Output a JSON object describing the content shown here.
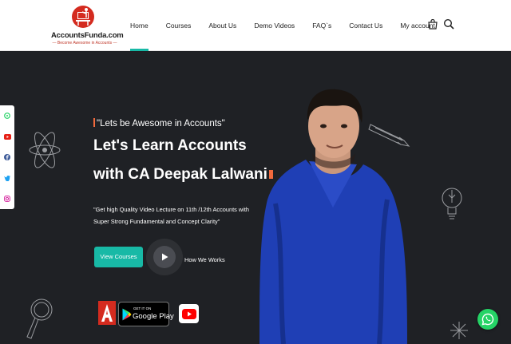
{
  "brand": {
    "name": "AccountsFunda.com",
    "tagline": "— Become Awesome in Accounts —",
    "color": "#d42b1f"
  },
  "nav": {
    "items": [
      {
        "label": "Home",
        "active": true
      },
      {
        "label": "Courses",
        "active": false
      },
      {
        "label": "About Us",
        "active": false
      },
      {
        "label": "Demo Videos",
        "active": false
      },
      {
        "label": "FAQ`s",
        "active": false
      },
      {
        "label": "Contact Us",
        "active": false
      },
      {
        "label": "My account",
        "active": false
      }
    ],
    "icons": [
      "cart-icon",
      "search-icon"
    ],
    "active_color": "#18b9a6"
  },
  "social": [
    "whatsapp-icon",
    "youtube-icon",
    "facebook-icon",
    "twitter-icon",
    "instagram-icon"
  ],
  "hero": {
    "tagline": "\"Lets be Awesome in Accounts\"",
    "headline_line1": "Let's Learn Accounts",
    "headline_line2": "with CA Deepak Lalwani",
    "description": "\"Get high Quality Video Lecture on 11th /12th Accounts with Super Strong Fundamental and Concept Clarity\"",
    "primary_button": "View Courses",
    "video_link": "How We Works",
    "accent_color": "#f26a3d",
    "button_color": "#18b9a6",
    "background": "#1f2125"
  },
  "apps": {
    "google_play_top": "GET IT ON",
    "google_play_bottom": "Google Play",
    "icons": [
      "accountsfunda-app-icon",
      "google-play-icon",
      "youtube-icon"
    ]
  }
}
